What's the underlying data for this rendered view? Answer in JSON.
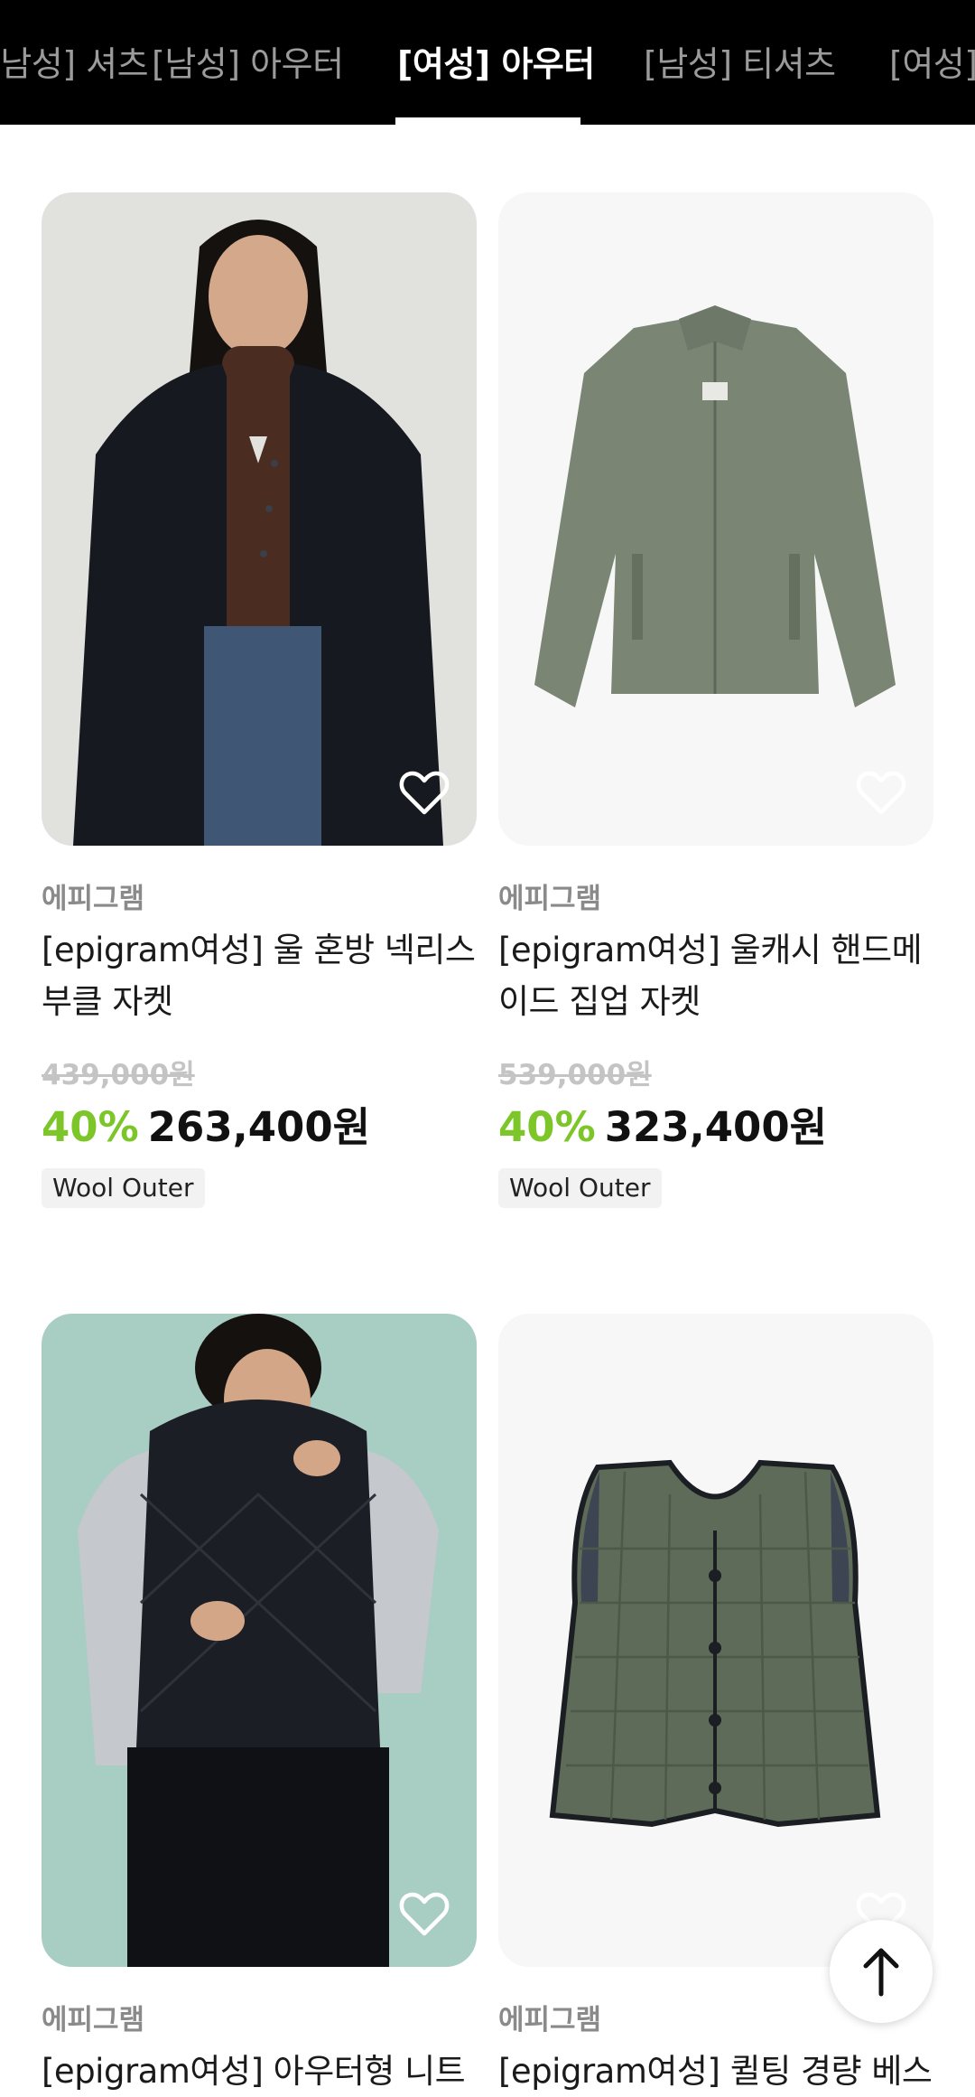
{
  "tabs": [
    {
      "label": "[남성] 셔츠",
      "active": false
    },
    {
      "label": "[남성] 아우터",
      "active": false
    },
    {
      "label": "[여성] 아우터",
      "active": true
    },
    {
      "label": "[남성] 티셔츠",
      "active": false
    },
    {
      "label": "[여성] 아우터",
      "active": false
    }
  ],
  "products": [
    {
      "brand": "에피그램",
      "name_line1": "[epigram여성] 울 혼방 넥리스",
      "name_line2": "부클 자켓",
      "original_price": "439,000원",
      "discount": "40%",
      "sale_price": "263,400원",
      "tag": "Wool Outer"
    },
    {
      "brand": "에피그램",
      "name_line1": "[epigram여성] 울캐시 핸드메",
      "name_line2": "이드 집업 자켓",
      "original_price": "539,000원",
      "discount": "40%",
      "sale_price": "323,400원",
      "tag": "Wool Outer"
    },
    {
      "brand": "에피그램",
      "name_line1": "[epigram여성] 아우터형 니트"
    },
    {
      "brand": "에피그램",
      "name_line1": "[epigram여성] 퀼팅 경량 베스"
    }
  ],
  "icons": {
    "heart": "heart-outline-icon",
    "scroll_top": "arrow-up-icon"
  },
  "colors": {
    "tabbar_bg": "#000000",
    "discount": "#7cc62a",
    "active_tab": "#ffffff",
    "inactive_tab": "#9b9b9b"
  }
}
